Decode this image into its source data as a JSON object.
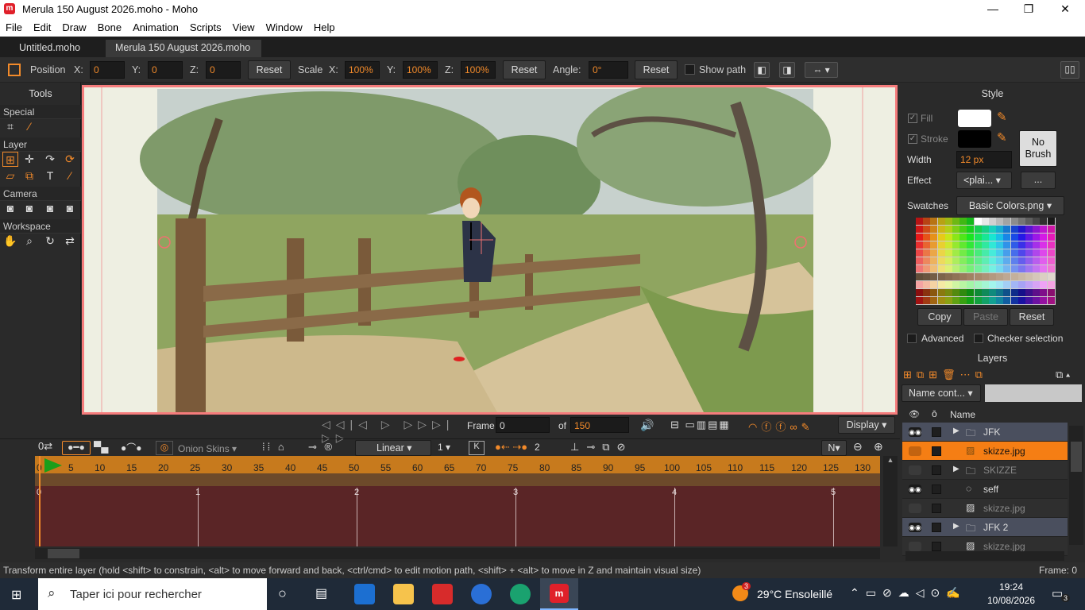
{
  "window": {
    "title": "Merula 150 August 2026.moho - Moho",
    "logo": "m",
    "minimize": "—",
    "maximize": "❐",
    "close": "✕"
  },
  "menu": [
    "File",
    "Edit",
    "Draw",
    "Bone",
    "Animation",
    "Scripts",
    "View",
    "Window",
    "Help"
  ],
  "tabs": [
    "Untitled.moho",
    "Merula 150 August 2026.moho"
  ],
  "tooloptions": {
    "position_label": "Position",
    "x_label": "X:",
    "x": "0",
    "y_label": "Y:",
    "y": "0",
    "z_label": "Z:",
    "z": "0",
    "reset1": "Reset",
    "scale_label": "Scale",
    "sx_label": "X:",
    "sx": "100%",
    "sy_label": "Y:",
    "sy": "100%",
    "sz_label": "Z:",
    "sz": "100%",
    "reset2": "Reset",
    "angle_label": "Angle:",
    "angle": "0°",
    "reset3": "Reset",
    "show_path": "Show path"
  },
  "tools": {
    "title": "Tools",
    "special": "Special",
    "layer": "Layer",
    "camera": "Camera",
    "workspace": "Workspace"
  },
  "style": {
    "title": "Style",
    "fill": "Fill",
    "stroke": "Stroke",
    "width_label": "Width",
    "width": "12 px",
    "no_brush": "No Brush",
    "effect_label": "Effect",
    "effect": "<plai...",
    "more": "...",
    "swatches_label": "Swatches",
    "swatches": "Basic Colors.png",
    "copy": "Copy",
    "paste": "Paste",
    "reset": "Reset",
    "advanced": "Advanced",
    "checker": "Checker selection",
    "fill_color": "#ffffff",
    "stroke_color": "#000000"
  },
  "layers": {
    "title": "Layers",
    "filter": "Name cont...",
    "name_header": "Name",
    "rows": [
      {
        "name": "JFK",
        "type": "group",
        "expander": "▶",
        "selected": false,
        "dim": false,
        "band": "#4a4f5e",
        "eye": true
      },
      {
        "name": "skizze.jpg",
        "type": "image",
        "expander": "",
        "selected": true,
        "dim": false,
        "band": "#f57e14",
        "eye": false
      },
      {
        "name": "SKIZZE",
        "type": "group",
        "expander": "▶",
        "selected": false,
        "dim": true,
        "band": "#2f2f2f",
        "eye": false
      },
      {
        "name": "seff",
        "type": "bone",
        "expander": "",
        "selected": false,
        "dim": false,
        "band": "#2a2a2a",
        "eye": true
      },
      {
        "name": "skizze.jpg",
        "type": "image",
        "expander": "",
        "selected": false,
        "dim": true,
        "band": "#2f2f2f",
        "eye": false
      },
      {
        "name": "JFK 2",
        "type": "group",
        "expander": "▶",
        "selected": false,
        "dim": false,
        "band": "#4a4f5e",
        "eye": true
      },
      {
        "name": "skizze.jpg",
        "type": "image",
        "expander": "",
        "selected": false,
        "dim": true,
        "band": "#2f2f2f",
        "eye": false
      }
    ]
  },
  "playback": {
    "frame_label": "Frame",
    "frame": "0",
    "of_label": "of",
    "total": "150",
    "display": "Display"
  },
  "timeline": {
    "onion": "Onion Skins",
    "interp": "Linear",
    "ease": "1",
    "keys_count": "2",
    "n_label": "N",
    "ruler": [
      "0",
      "5",
      "10",
      "15",
      "20",
      "25",
      "30",
      "35",
      "40",
      "45",
      "50",
      "55",
      "60",
      "65",
      "70",
      "75",
      "80",
      "85",
      "90",
      "95",
      "100",
      "105",
      "110",
      "115",
      "120",
      "125",
      "130"
    ],
    "seconds": [
      "0",
      "1",
      "2",
      "3",
      "4",
      "5"
    ]
  },
  "status": {
    "text": "Transform entire layer (hold <shift> to constrain, <alt> to move forward and back, <ctrl/cmd> to edit motion path, <shift> + <alt> to move in Z and maintain visual size)",
    "frame": "Frame: 0"
  },
  "taskbar": {
    "search": "Taper ici pour rechercher",
    "weather": "29°C  Ensoleillé",
    "weather_badge": "3",
    "time": "19:24",
    "date": "10/08/2026",
    "notif": "3"
  }
}
